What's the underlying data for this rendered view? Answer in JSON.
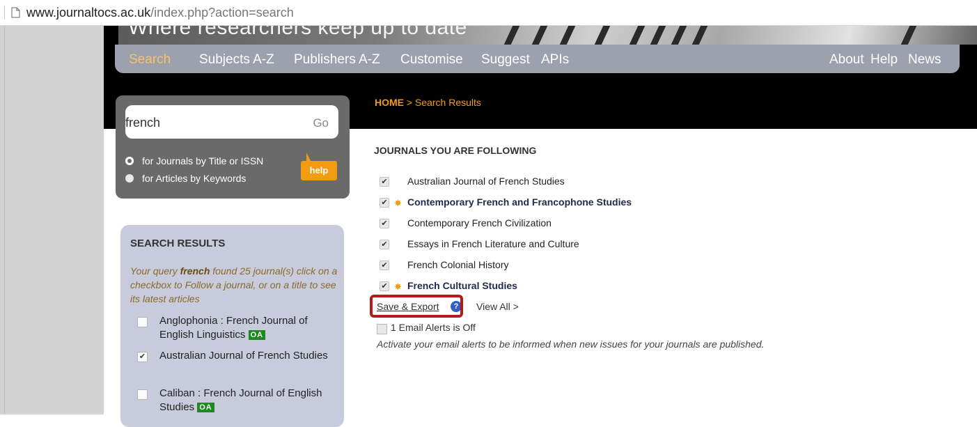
{
  "browser": {
    "url_host": "www.journaltocs.ac.uk",
    "url_path": "/index.php?action=search"
  },
  "banner": {
    "tagline": "Where researchers keep up to date"
  },
  "nav": {
    "left_items": [
      "Search",
      "Subjects A-Z",
      "Publishers A-Z",
      "Customise",
      "Suggest",
      "APIs"
    ],
    "right_items": [
      "About",
      "Help",
      "News"
    ],
    "active": "Search"
  },
  "search": {
    "query": "french",
    "go_label": "Go",
    "option_journals": "for Journals by Title or ISSN",
    "option_articles": "for Articles by Keywords",
    "help_label": "help"
  },
  "breadcrumb": {
    "home": "HOME",
    "separator": " > ",
    "current": "Search Results"
  },
  "following": {
    "heading": "JOURNALS YOU ARE FOLLOWING",
    "items": [
      {
        "title": "Australian Journal of French Studies",
        "checked": true,
        "new": false
      },
      {
        "title": "Contemporary French and Francophone Studies",
        "checked": true,
        "new": true
      },
      {
        "title": "Contemporary French Civilization",
        "checked": true,
        "new": false
      },
      {
        "title": "Essays in French Literature and Culture",
        "checked": true,
        "new": false
      },
      {
        "title": "French Colonial History",
        "checked": true,
        "new": false
      },
      {
        "title": "French Cultural Studies",
        "checked": true,
        "new": true
      }
    ],
    "save_export_label": "Save & Export",
    "view_all_label": "View All >",
    "email_status": "1 Email Alerts is Off",
    "email_note": "Activate your email alerts to be informed when new issues for your journals are published."
  },
  "results": {
    "heading": "SEARCH RESULTS",
    "desc_prefix": "Your query ",
    "desc_query": "french",
    "desc_suffix": " found 25 journal(s) click on a checkbox to Follow a journal, or on a title to see its latest articles",
    "oa_label": "OA",
    "items": [
      {
        "title": "Anglophonia : French Journal of English Linguistics",
        "checked": false,
        "oa": true
      },
      {
        "title": "Australian Journal of French Studies",
        "checked": true,
        "oa": false
      },
      {
        "title": "Caliban : French Journal of English Studies",
        "checked": false,
        "oa": true
      }
    ]
  },
  "colors": {
    "accent_orange": "#f39c12",
    "nav_bg": "#9da0ad",
    "results_bg": "#c7cbdc",
    "highlight_red": "#b31b1b",
    "oa_green": "#1d8a1d"
  }
}
